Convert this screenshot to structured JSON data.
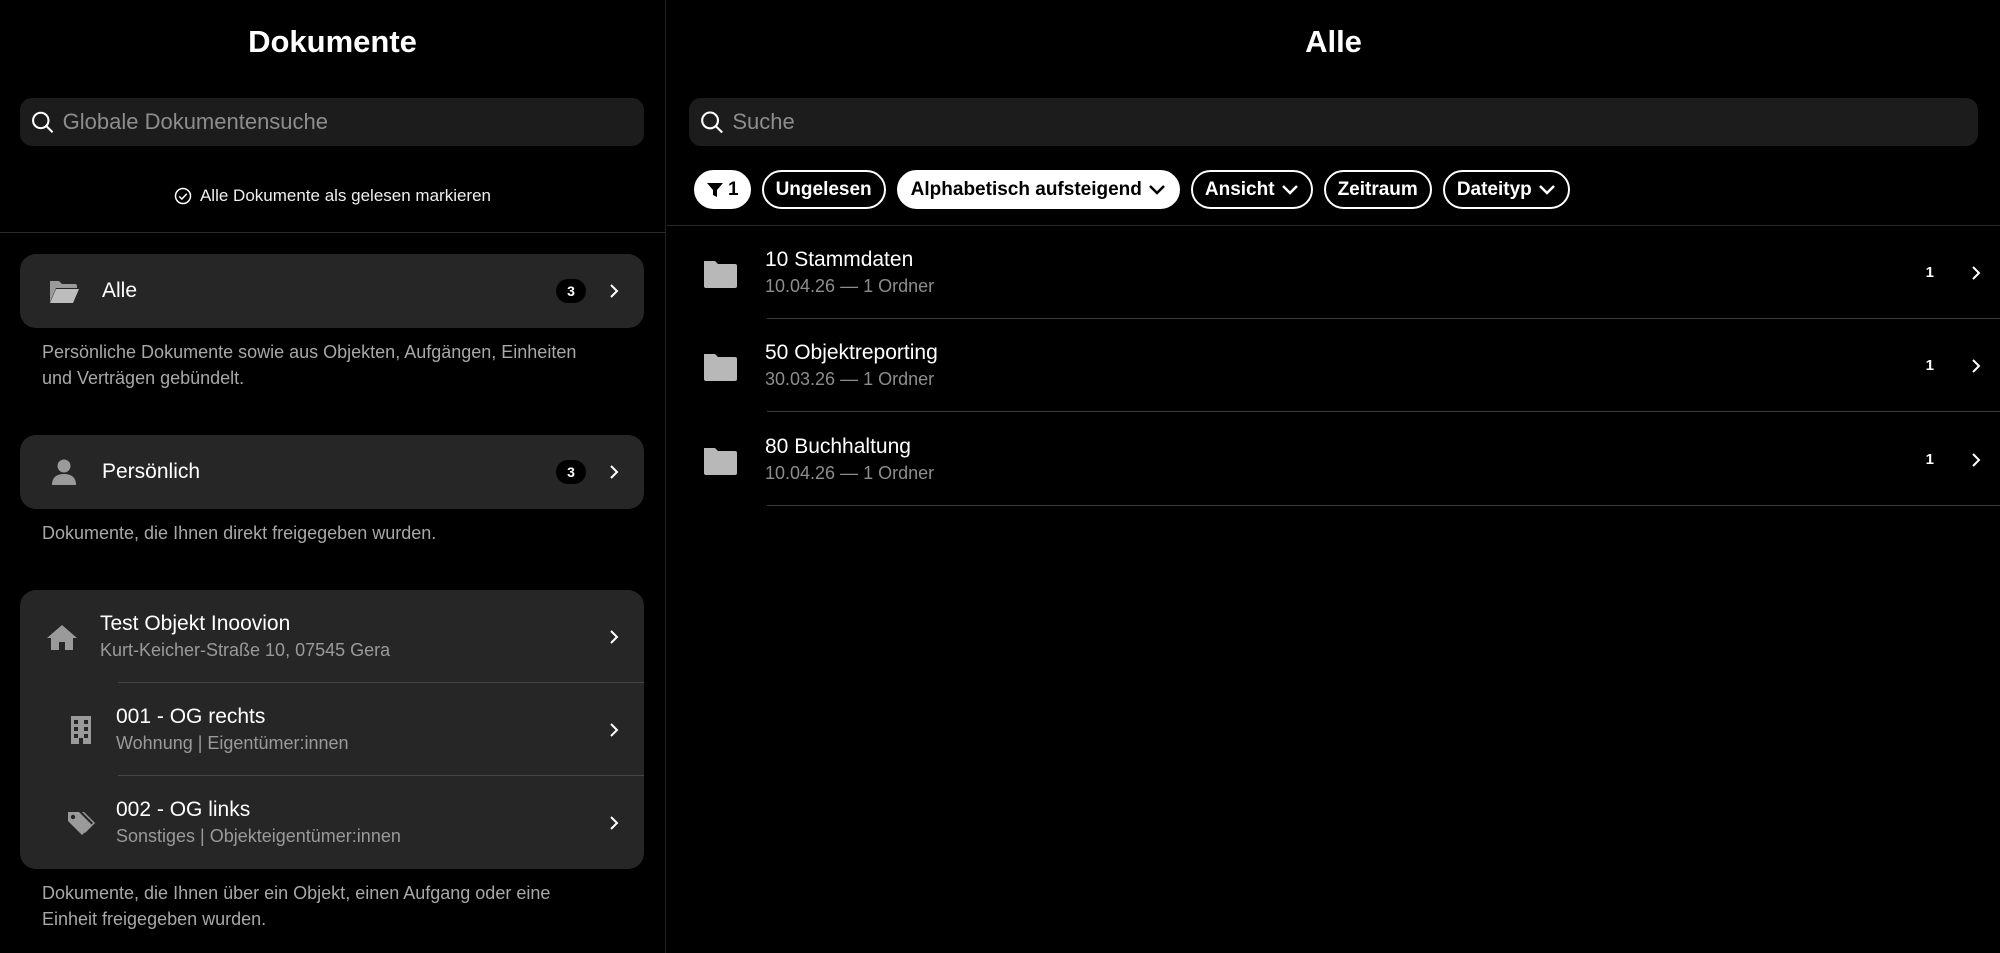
{
  "left": {
    "title": "Dokumente",
    "search_placeholder": "Globale Dokumentensuche",
    "mark_all_read": "Alle Dokumente als gelesen markieren",
    "sections": {
      "alle": {
        "label": "Alle",
        "count": "3",
        "description": "Persönliche Dokumente sowie aus Objekten, Aufgängen, Einheiten und Verträgen gebündelt."
      },
      "persoenlich": {
        "label": "Persönlich",
        "count": "3",
        "description": "Dokumente, die Ihnen direkt freigegeben wurden."
      }
    },
    "objects": {
      "main": {
        "name": "Test Objekt Inoovion",
        "address": "Kurt-Keicher-Straße 10, 07545 Gera"
      },
      "units": [
        {
          "name": "001 - OG rechts",
          "meta": "Wohnung | Eigentümer:innen"
        },
        {
          "name": "002 - OG links",
          "meta": "Sonstiges | Objekteigentümer:innen"
        }
      ],
      "description": "Dokumente, die Ihnen über ein Objekt, einen Aufgang oder eine Einheit freigegeben wurden."
    }
  },
  "right": {
    "title": "Alle",
    "search_placeholder": "Suche",
    "filters": {
      "filter_count": "1",
      "unread": "Ungelesen",
      "sort": "Alphabetisch aufsteigend",
      "view": "Ansicht",
      "period": "Zeitraum",
      "filetype": "Dateityp"
    },
    "folders": [
      {
        "name": "10 Stammdaten",
        "meta": "10.04.26 — 1 Ordner",
        "count": "1"
      },
      {
        "name": "50 Objektreporting",
        "meta": "30.03.26 — 1 Ordner",
        "count": "1"
      },
      {
        "name": "80 Buchhaltung",
        "meta": "10.04.26 — 1 Ordner",
        "count": "1"
      }
    ]
  },
  "colors": {
    "background": "#000000",
    "card": "#262626",
    "input": "#1c1c1c",
    "muted_text": "#a8a8a8"
  }
}
